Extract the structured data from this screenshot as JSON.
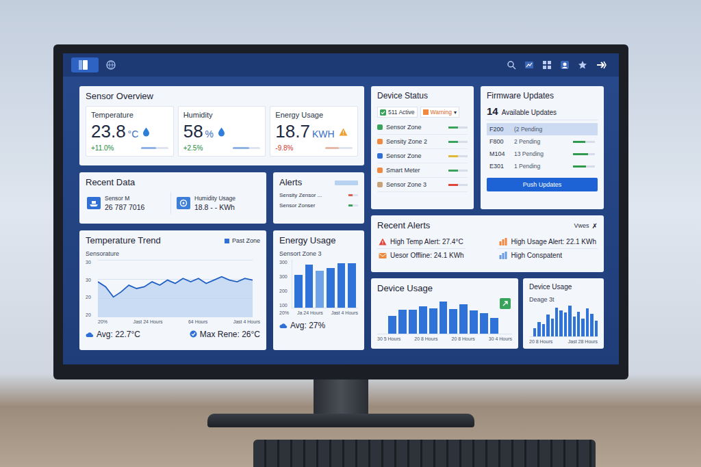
{
  "sensor_overview": {
    "title": "Sensor Overview",
    "metrics": [
      {
        "label": "Temperature",
        "value": "23.8",
        "unit": "°C",
        "change": "+11.0%",
        "trend": "up",
        "alert": false,
        "level": 0.55
      },
      {
        "label": "Humidity",
        "value": "58",
        "unit": "%",
        "change": "+2.5%",
        "trend": "up",
        "alert": false,
        "level": 0.6
      },
      {
        "label": "Energy Usage",
        "value": "18.7",
        "unit": "KWH",
        "change": "-9.8%",
        "trend": "down",
        "alert": true,
        "level": 0.5
      }
    ]
  },
  "recent_data": {
    "title": "Recent Data",
    "items": [
      {
        "label": "Sensor M",
        "value": "26 787 7016",
        "kind": "sensor"
      },
      {
        "label": "Humidity Usage",
        "value": "18.8 - - KWh",
        "kind": "humidity"
      }
    ]
  },
  "alerts": {
    "title": "Alerts",
    "items": [
      {
        "label": "Sensity Zensor ...",
        "color": "#e05a4f",
        "level": 0.45
      },
      {
        "label": "Sensor Zonser",
        "color": "#3aa35b",
        "level": 0.45
      }
    ]
  },
  "temperature_trend": {
    "title": "Temperature Trend",
    "legend": "Past Zone",
    "axis_label": "Sensorature",
    "y_ticks": [
      "30",
      "30",
      "20",
      "20"
    ],
    "x_ticks": [
      "20%",
      "Jast 24 Hours",
      "64 Hours",
      "Jast 4 Hours"
    ],
    "series": [
      25.5,
      24,
      21,
      22.5,
      24.5,
      23.5,
      24,
      25.5,
      24.5,
      26,
      25,
      26.5,
      25.5,
      26.5,
      25,
      26,
      27,
      26,
      25.5,
      26.5,
      26
    ],
    "avg": "Avg: 22.7°C",
    "max": "Max Rene: 26°C"
  },
  "energy_usage": {
    "title": "Energy Usage",
    "subtitle": "Sensort Zone 3",
    "y_ticks": [
      "300",
      "300",
      "200",
      "100"
    ],
    "x_ticks": [
      "20%",
      "Ja 24 Hours",
      "Jast 4 Hours"
    ],
    "series": [
      220,
      290,
      250,
      265,
      300,
      300
    ],
    "avg": "Avg: 27%"
  },
  "device_status": {
    "title": "Device Status",
    "filter": {
      "active": "511 Active",
      "warning": "Warning",
      "caret": "▾"
    },
    "items": [
      {
        "name": "Sensor Zone",
        "color": "#3aa35b",
        "bar_color": "#3aa35b",
        "level": 0.5
      },
      {
        "name": "Sensity Zone 2",
        "color": "#f0883e",
        "bar_color": "#3aa35b",
        "level": 0.5
      },
      {
        "name": "Sensor Zone",
        "color": "#2f6fd6",
        "bar_color": "#e0b93a",
        "level": 0.5
      },
      {
        "name": "Smart Meter",
        "color": "#f0883e",
        "bar_color": "#3aa35b",
        "level": 0.5
      },
      {
        "name": "Sensor Zone 3",
        "color": "#c9a27a",
        "bar_color": "#e0453a",
        "level": 0.5
      }
    ]
  },
  "firmware_updates": {
    "title": "Firmware Updates",
    "count": "14",
    "count_label": "Available Updates",
    "rows": [
      {
        "code": "F200",
        "status": "(2 Pending",
        "selected": true,
        "level": 0
      },
      {
        "code": "F800",
        "status": "2 Pending",
        "selected": false,
        "level": 0.55
      },
      {
        "code": "M104",
        "status": "13 Pending",
        "selected": false,
        "level": 0.7
      },
      {
        "code": "E301",
        "status": "1 Pending",
        "selected": false,
        "level": 0.6
      }
    ],
    "button": "Push Updates"
  },
  "recent_alerts": {
    "title": "Recent Alerts",
    "action": "Vwes",
    "close": "✗",
    "items": [
      {
        "text": "High Temp Alert: 27.4°C",
        "kind": "warning",
        "color": "#e0453a"
      },
      {
        "text": "High Usage Alert: 22.1 KWh",
        "kind": "usage",
        "color": "#f0883e"
      },
      {
        "text": "Uesor Offline: 24.1 KWh",
        "kind": "mail",
        "color": "#f0883e"
      },
      {
        "text": "High Conspatent",
        "kind": "usage",
        "color": "#6b9be0"
      }
    ]
  },
  "device_usage": {
    "title": "Device Usage",
    "x_ticks": [
      "30 5 Hours",
      "20 8 Hours",
      "20 8 Hours",
      "30 4 Hours"
    ],
    "series": [
      40,
      55,
      55,
      62,
      58,
      72,
      56,
      66,
      52,
      46,
      36
    ]
  },
  "device_usage_small": {
    "title": "Device Usage",
    "subtitle": "Deage 3t",
    "x_ticks": [
      "20 8 Hours",
      "Jast 28 Hours"
    ],
    "series": [
      20,
      35,
      30,
      55,
      45,
      72,
      66,
      60,
      78,
      50,
      62,
      44,
      70,
      56,
      40
    ]
  }
}
